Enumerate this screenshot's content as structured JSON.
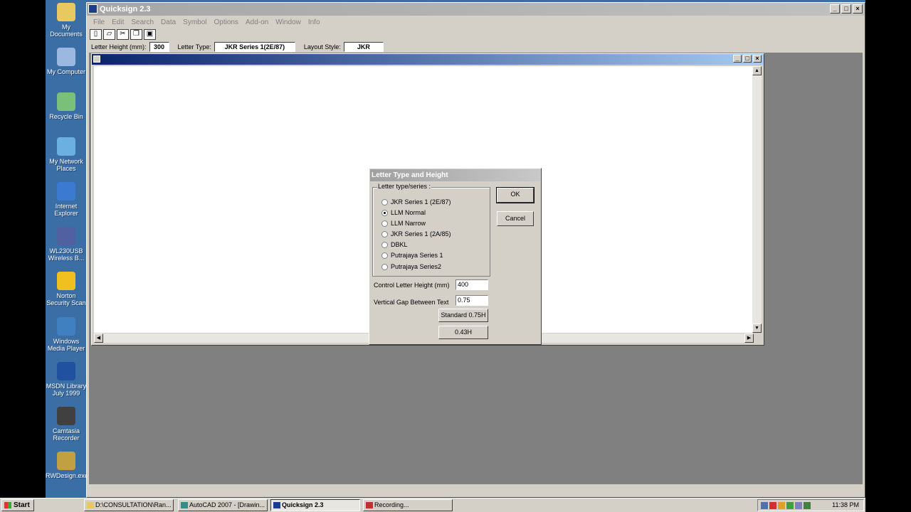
{
  "desktop_icons": [
    {
      "label": "My Documents",
      "color": "#e8c860"
    },
    {
      "label": "My Computer",
      "color": "#9ab8e0"
    },
    {
      "label": "Recycle Bin",
      "color": "#7ac07a"
    },
    {
      "label": "My Network Places",
      "color": "#6ab0e0"
    },
    {
      "label": "Internet Explorer",
      "color": "#3a7ad0"
    },
    {
      "label": "WL230USB Wireless B...",
      "color": "#5060a0"
    },
    {
      "label": "Norton Security Scan",
      "color": "#f0c020"
    },
    {
      "label": "Windows Media Player",
      "color": "#4080c0"
    },
    {
      "label": "MSDN Library July 1999",
      "color": "#2050a0"
    },
    {
      "label": "Camtasia Recorder",
      "color": "#404040"
    },
    {
      "label": "RWDesign.exe",
      "color": "#c0a040"
    }
  ],
  "app": {
    "title": "Quicksign 2.3",
    "menu": [
      "File",
      "Edit",
      "Search",
      "Data",
      "Symbol",
      "Options",
      "Add-on",
      "Window",
      "Info"
    ],
    "info": {
      "letter_height_label": "Letter Height (mm):",
      "letter_height_value": "300",
      "letter_type_label": "Letter Type:",
      "letter_type_value": "JKR Series 1(2E/87)",
      "layout_style_label": "Layout Style:",
      "layout_style_value": "JKR"
    }
  },
  "dialog": {
    "title": "Letter Type and Height",
    "group_label": "Letter type/series :",
    "options": [
      {
        "label": "JKR Series 1 (2E/87)",
        "selected": false
      },
      {
        "label": "LLM Normal",
        "selected": true
      },
      {
        "label": "LLM Narrow",
        "selected": false
      },
      {
        "label": "JKR Series 1 (2A/85)",
        "selected": false
      },
      {
        "label": "DBKL",
        "selected": false
      },
      {
        "label": "Putrajaya Series 1",
        "selected": false
      },
      {
        "label": "Putrajaya Series2",
        "selected": false
      }
    ],
    "ok_label": "OK",
    "cancel_label": "Cancel",
    "control_height_label": "Control Letter Height (mm)",
    "control_height_value": "400",
    "vertical_gap_label": "Vertical Gap Between Text",
    "vertical_gap_value": "0.75",
    "standard_btn_label": "Standard 0.75H",
    "h043_btn_label": "0.43H"
  },
  "taskbar": {
    "start_label": "Start",
    "tasks": [
      {
        "label": "D:\\CONSULTATION\\Ran...",
        "active": false
      },
      {
        "label": "AutoCAD 2007 - [Drawin...",
        "active": false
      },
      {
        "label": "Quicksign 2.3",
        "active": true
      },
      {
        "label": "Recording...",
        "active": false
      }
    ],
    "clock": "11:38 PM"
  }
}
